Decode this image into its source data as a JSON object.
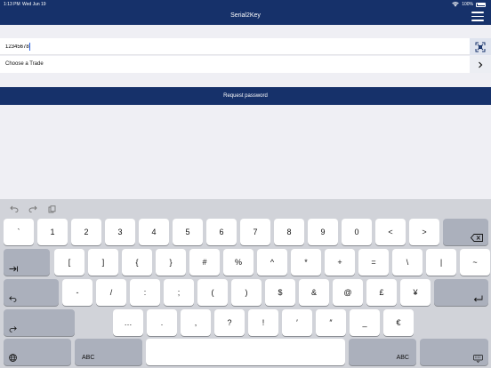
{
  "status": {
    "time": "1:13 PM",
    "date": "Wed Jun 19",
    "battery": "100%"
  },
  "nav": {
    "title": "Serial2Key"
  },
  "form": {
    "serial_value": "12345678",
    "trade_label": "Choose a Trade",
    "request_label": "Request password"
  },
  "keyboard": {
    "row1": [
      "`",
      "1",
      "2",
      "3",
      "4",
      "5",
      "6",
      "7",
      "8",
      "9",
      "0",
      "<",
      ">"
    ],
    "row2": [
      "[",
      "]",
      "{",
      "}",
      "#",
      "%",
      "^",
      "*",
      "+",
      "=",
      "\\",
      "|",
      "~"
    ],
    "row3": [
      "-",
      "/",
      ":",
      ";",
      "(",
      ")",
      "$",
      "&",
      "@",
      "£",
      "¥"
    ],
    "row4": [
      "…",
      ".",
      ",",
      "?",
      "!",
      "′",
      "″",
      "_",
      "€"
    ],
    "abc_left": "ABC",
    "abc_right": "ABC"
  }
}
